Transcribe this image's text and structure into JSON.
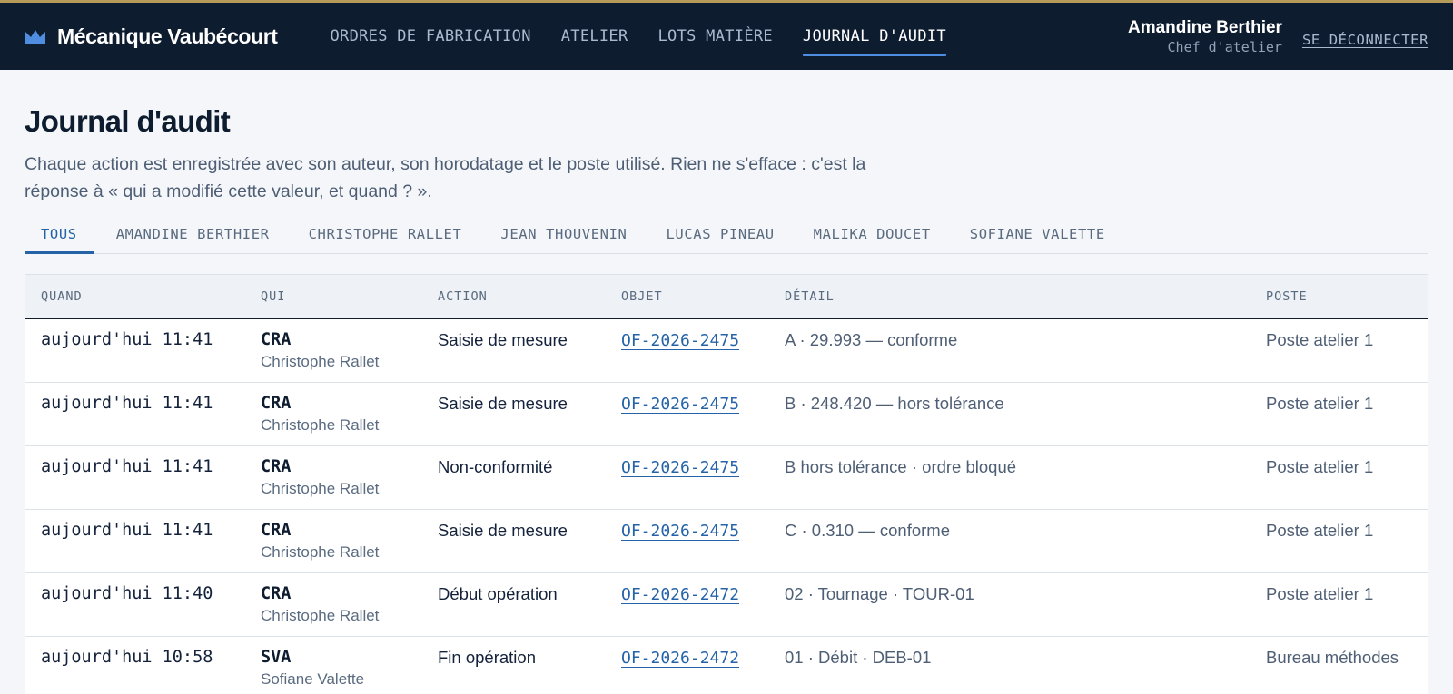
{
  "header": {
    "brand": "Mécanique Vaubécourt",
    "brand_icon": "crown-icon",
    "nav": [
      {
        "label": "ORDRES DE FABRICATION",
        "active": false
      },
      {
        "label": "ATELIER",
        "active": false
      },
      {
        "label": "LOTS MATIÈRE",
        "active": false
      },
      {
        "label": "JOURNAL D'AUDIT",
        "active": true
      }
    ],
    "user": {
      "name": "Amandine Berthier",
      "role": "Chef d'atelier"
    },
    "logout_label": "SE DÉCONNECTER"
  },
  "page": {
    "title": "Journal d'audit",
    "description": "Chaque action est enregistrée avec son auteur, son horodatage et le poste utilisé. Rien ne s'efface : c'est la réponse à « qui a modifié cette valeur, et quand ? »."
  },
  "tabs": [
    {
      "label": "TOUS",
      "active": true
    },
    {
      "label": "AMANDINE BERTHIER",
      "active": false
    },
    {
      "label": "CHRISTOPHE RALLET",
      "active": false
    },
    {
      "label": "JEAN THOUVENIN",
      "active": false
    },
    {
      "label": "LUCAS PINEAU",
      "active": false
    },
    {
      "label": "MALIKA DOUCET",
      "active": false
    },
    {
      "label": "SOFIANE VALETTE",
      "active": false
    }
  ],
  "table": {
    "headers": {
      "when": "QUAND",
      "who": "QUI",
      "action": "ACTION",
      "object": "OBJET",
      "detail": "DÉTAIL",
      "post": "POSTE"
    },
    "rows": [
      {
        "when": "aujourd'hui 11:41",
        "who_code": "CRA",
        "who_name": "Christophe Rallet",
        "action": "Saisie de mesure",
        "object": "OF-2026-2475",
        "detail": "A · 29.993 — conforme",
        "post": "Poste atelier 1"
      },
      {
        "when": "aujourd'hui 11:41",
        "who_code": "CRA",
        "who_name": "Christophe Rallet",
        "action": "Saisie de mesure",
        "object": "OF-2026-2475",
        "detail": "B · 248.420 — hors tolérance",
        "post": "Poste atelier 1"
      },
      {
        "when": "aujourd'hui 11:41",
        "who_code": "CRA",
        "who_name": "Christophe Rallet",
        "action": "Non-conformité",
        "object": "OF-2026-2475",
        "detail": "B hors tolérance · ordre bloqué",
        "post": "Poste atelier 1"
      },
      {
        "when": "aujourd'hui 11:41",
        "who_code": "CRA",
        "who_name": "Christophe Rallet",
        "action": "Saisie de mesure",
        "object": "OF-2026-2475",
        "detail": "C · 0.310 — conforme",
        "post": "Poste atelier 1"
      },
      {
        "when": "aujourd'hui 11:40",
        "who_code": "CRA",
        "who_name": "Christophe Rallet",
        "action": "Début opération",
        "object": "OF-2026-2472",
        "detail": "02 · Tournage · TOUR-01",
        "post": "Poste atelier 1"
      },
      {
        "when": "aujourd'hui 10:58",
        "who_code": "SVA",
        "who_name": "Sofiane Valette",
        "action": "Fin opération",
        "object": "OF-2026-2472",
        "detail": "01 · Débit · DEB-01",
        "post": "Bureau méthodes"
      }
    ]
  },
  "colors": {
    "nav_bg": "#0e1c2f",
    "accent": "#2563a8",
    "nav_underline": "#4f8de0",
    "brand_icon": "#4f8de0"
  }
}
